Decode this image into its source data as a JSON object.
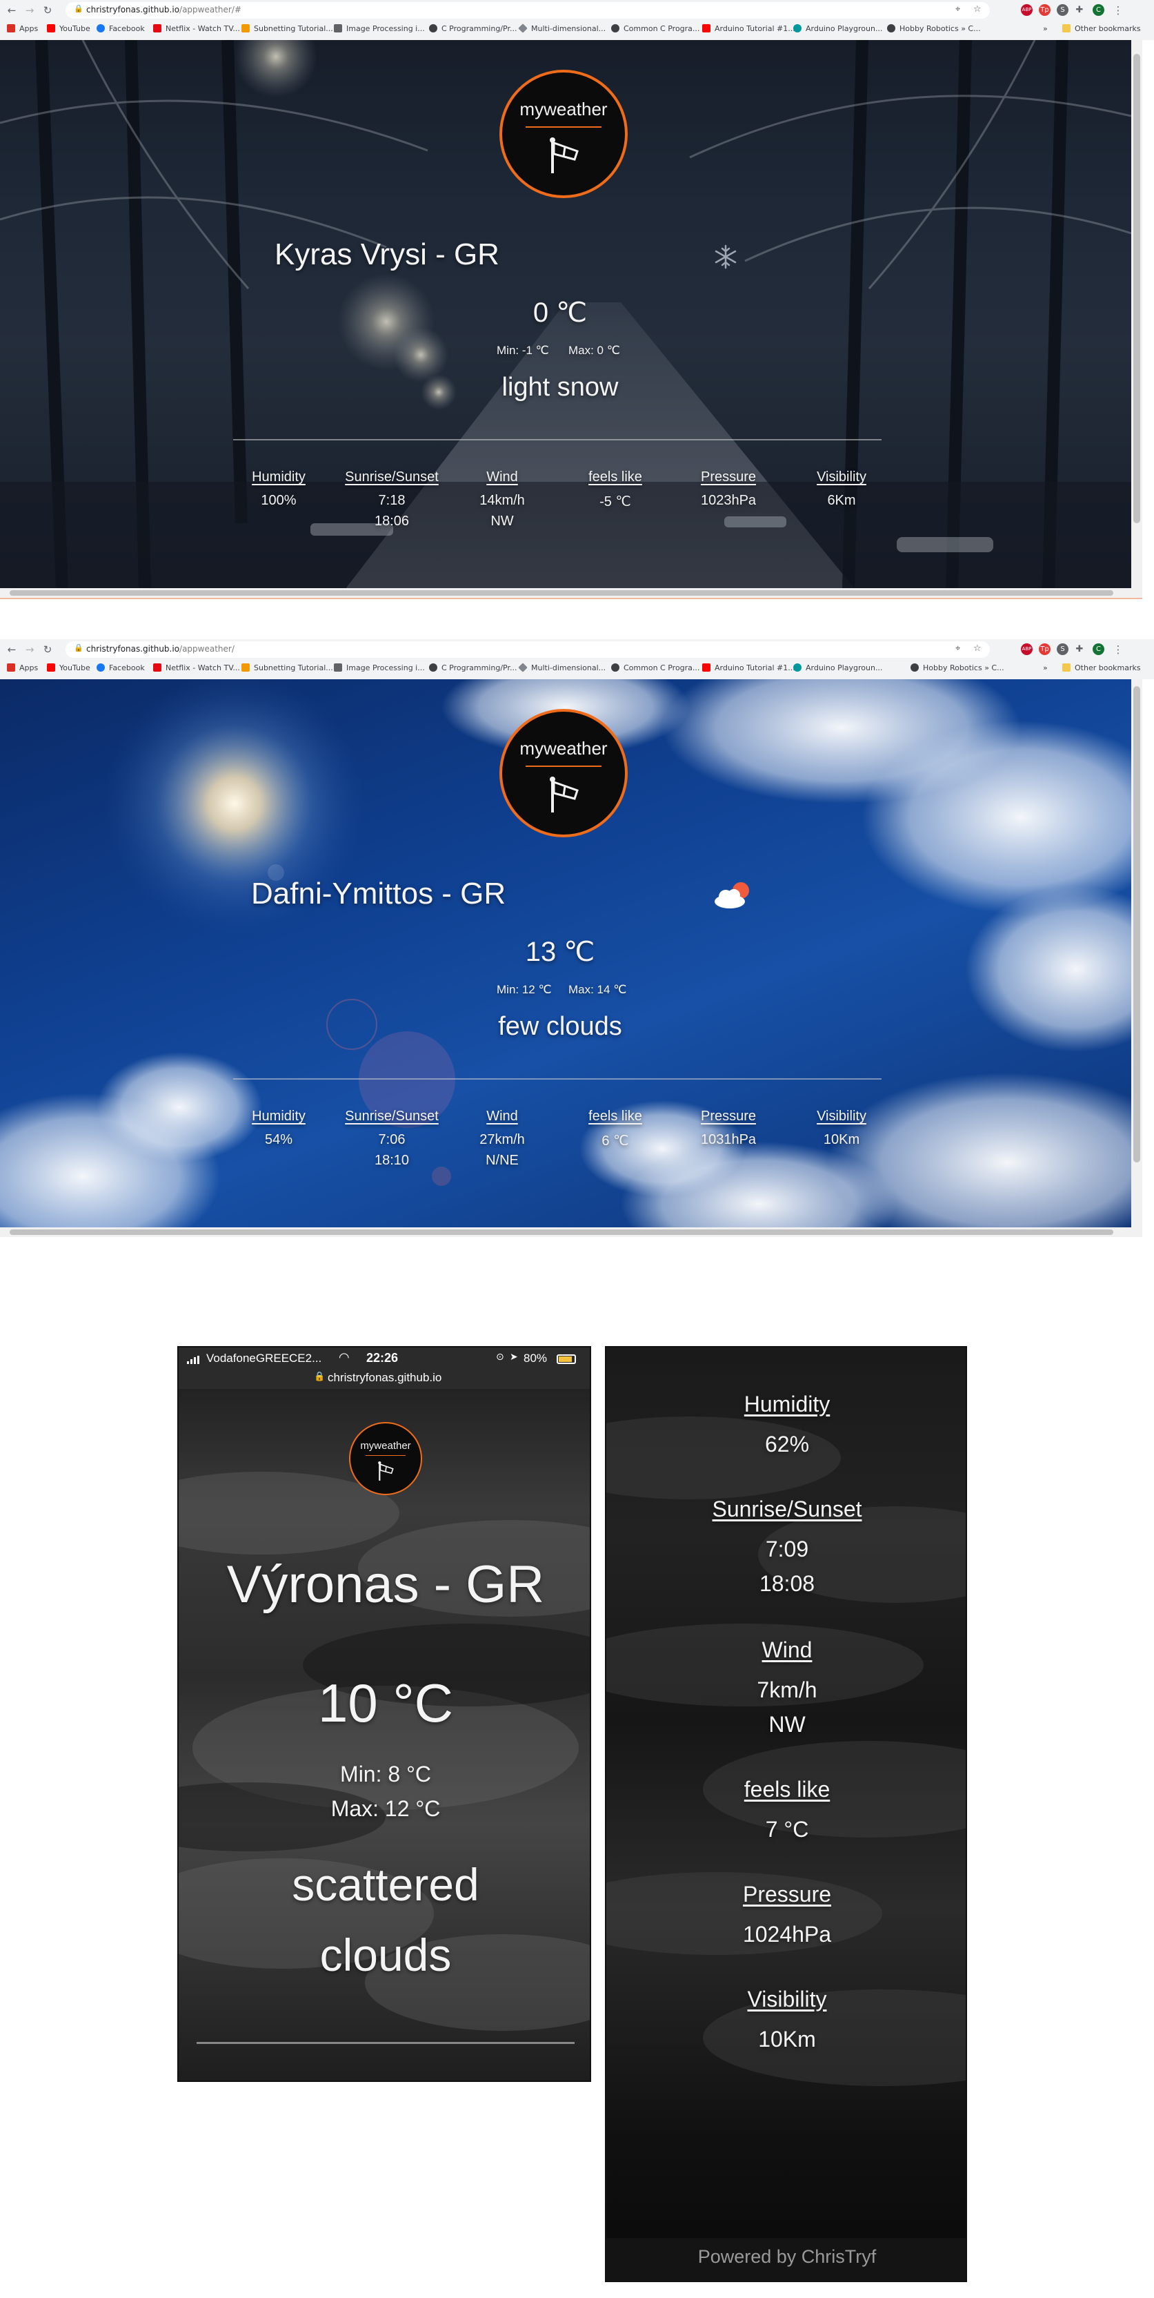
{
  "browser": {
    "url_host": "christryfonas.github.io",
    "url_path_1": "/appweather/#",
    "url_path_2": "/appweather/",
    "bookmarks": [
      {
        "label": "Apps",
        "color": "#d93025"
      },
      {
        "label": "YouTube",
        "color": "#ff0000"
      },
      {
        "label": "Facebook",
        "color": "#1877f2"
      },
      {
        "label": "Netflix - Watch TV...",
        "color": "#e50914"
      },
      {
        "label": "Subnetting Tutorial...",
        "color": "#f29900"
      },
      {
        "label": "Image Processing i...",
        "color": "#5f6368"
      },
      {
        "label": "C Programming/Pr...",
        "color": "#3c4043"
      },
      {
        "label": "Multi-dimensional...",
        "color": "#80868b"
      },
      {
        "label": "Common C Progra...",
        "color": "#3c4043"
      },
      {
        "label": "Arduino Tutorial #1...",
        "color": "#ff0000"
      },
      {
        "label": "Arduino Playgroun...",
        "color": "#00979d"
      },
      {
        "label": "Hobby Robotics » C...",
        "color": "#3c4043"
      }
    ],
    "more_bookmarks": "»",
    "other_bookmarks": "Other bookmarks",
    "extensions": [
      {
        "label": "ABP",
        "color": "#c70d2c"
      },
      {
        "label": "Tp",
        "color": "#e53935"
      },
      {
        "label": "S",
        "color": "#5f6368"
      },
      {
        "label": "C",
        "color": "#137333"
      }
    ]
  },
  "logo": {
    "title": "myweather"
  },
  "page1": {
    "city": "Kyras Vrysi - GR",
    "temp": "0 ℃",
    "min": "Min: -1 ℃",
    "max": "Max: 0 ℃",
    "description": "light snow",
    "icon": "snowflake-icon",
    "stats": [
      {
        "label": "Humidity",
        "value": "100%",
        "value2": ""
      },
      {
        "label": "Sunrise/Sunset",
        "value": "7:18",
        "value2": "18:06"
      },
      {
        "label": "Wind",
        "value": "14km/h",
        "value2": "NW"
      },
      {
        "label": "feels like",
        "value": "-5 ℃",
        "value2": ""
      },
      {
        "label": "Pressure",
        "value": "1023hPa",
        "value2": ""
      },
      {
        "label": "Visibility",
        "value": "6Km",
        "value2": ""
      }
    ]
  },
  "page2": {
    "city": "Dafni-Ymittos - GR",
    "temp": "13 ℃",
    "min": "Min: 12 ℃",
    "max": "Max: 14 ℃",
    "description": "few clouds",
    "icon": "sun-cloud-icon",
    "stats": [
      {
        "label": "Humidity",
        "value": "54%",
        "value2": ""
      },
      {
        "label": "Sunrise/Sunset",
        "value": "7:06",
        "value2": "18:10"
      },
      {
        "label": "Wind",
        "value": "27km/h",
        "value2": "N/NE"
      },
      {
        "label": "feels like",
        "value": "6 ℃",
        "value2": ""
      },
      {
        "label": "Pressure",
        "value": "1031hPa",
        "value2": ""
      },
      {
        "label": "Visibility",
        "value": "10Km",
        "value2": ""
      }
    ]
  },
  "phone1": {
    "carrier": "VodafoneGREECE2...",
    "time": "22:26",
    "battery": "80%",
    "site": "christryfonas.github.io",
    "city": "Výronas - GR",
    "temp": "10 °C",
    "min": "Min: 8 °C",
    "max": "Max: 12 °C",
    "description_line1": "scattered",
    "description_line2": "clouds"
  },
  "phone2": {
    "stats": [
      {
        "label": "Humidity",
        "value": "62%",
        "value2": ""
      },
      {
        "label": "Sunrise/Sunset",
        "value": "7:09",
        "value2": "18:08"
      },
      {
        "label": "Wind",
        "value": "7km/h",
        "value2": "NW"
      },
      {
        "label": "feels like",
        "value": "7 °C",
        "value2": ""
      },
      {
        "label": "Pressure",
        "value": "1024hPa",
        "value2": ""
      },
      {
        "label": "Visibility",
        "value": "10Km",
        "value2": ""
      }
    ],
    "footer": "Powered by ChrisTryf"
  }
}
